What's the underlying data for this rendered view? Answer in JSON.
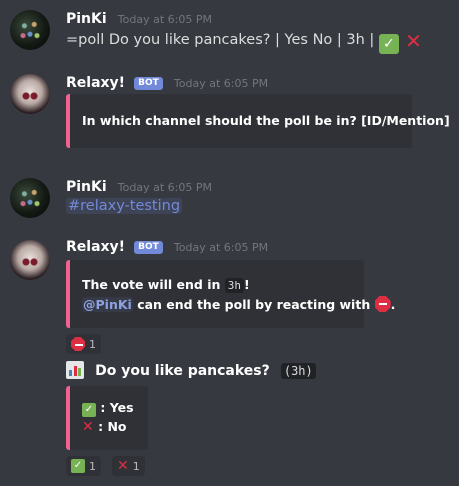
{
  "messages": [
    {
      "author": "PinKi",
      "timestamp": "Today at 6:05 PM",
      "text_prefix": "=poll Do you like pancakes? | Yes No | 3h |",
      "emojis": [
        "white-check-mark",
        "cross-mark"
      ]
    },
    {
      "author": "Relaxy!",
      "bot_tag": "BOT",
      "timestamp": "Today at 6:05 PM",
      "embed_text": "In which channel should the poll be in? [ID/Mention]"
    },
    {
      "author": "PinKi",
      "timestamp": "Today at 6:05 PM",
      "channel_mention": "#relaxy-testing"
    },
    {
      "author": "Relaxy!",
      "bot_tag": "BOT",
      "timestamp": "Today at 6:05 PM",
      "embed": {
        "line1_prefix": "The vote will end in",
        "line1_code": "3h",
        "line1_suffix": "!",
        "line2_mention": "@PinKi",
        "line2_text": "can end the poll by reacting with",
        "line2_suffix": "."
      },
      "reaction": {
        "emoji": "stop-sign",
        "count": "1"
      }
    }
  ],
  "poll": {
    "title": "Do you like pancakes?",
    "duration_code": "(3h)",
    "options": [
      {
        "emoji": "white-check-mark",
        "label": ": Yes"
      },
      {
        "emoji": "cross-mark",
        "label": ": No"
      }
    ],
    "reactions": [
      {
        "emoji": "white-check-mark",
        "count": "1"
      },
      {
        "emoji": "cross-mark",
        "count": "1"
      }
    ]
  },
  "colors": {
    "background": "#36393f",
    "embed_background": "#2f3136",
    "embed_accent": "#f06292",
    "bot_tag": "#7289da",
    "mention": "#8ea1e1"
  }
}
